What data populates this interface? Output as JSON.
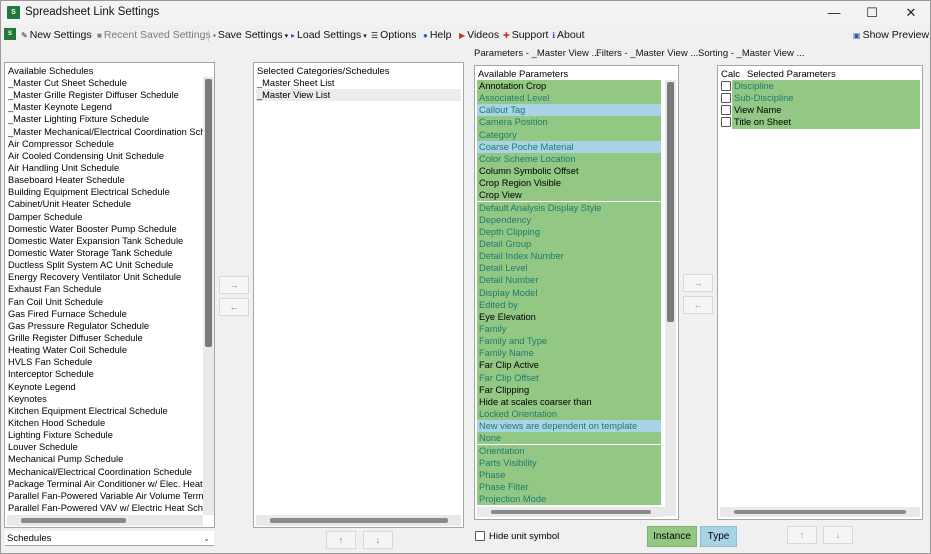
{
  "window": {
    "title": "Spreadsheet Link Settings",
    "app_icon": "S",
    "controls": {
      "minimize": "—",
      "maximize": "☐",
      "close": "✕"
    }
  },
  "toolbar": {
    "new_settings": "New Settings",
    "recent_saved_settings": "Recent Saved Settings",
    "save_settings": "Save Settings",
    "load_settings": "Load Settings",
    "options": "Options",
    "help": "Help",
    "videos": "Videos",
    "support": "Support",
    "about": "About",
    "show_preview": "Show Preview"
  },
  "headers": {
    "parameters": "Parameters - _Master View ...",
    "filters": "Filters - _Master View ...",
    "sorting": "Sorting - _Master View ..."
  },
  "available_schedules": {
    "title": "Available Schedules",
    "items": [
      "_Master Cut Sheet Schedule",
      "_Master Grille Register Diffuser Schedule",
      "_Master Keynote Legend",
      "_Master Lighting Fixture Schedule",
      "_Master Mechanical/Electrical Coordination Sch",
      "Air Compressor Schedule",
      "Air Cooled Condensing Unit Schedule",
      "Air Handling Unit Schedule",
      "Baseboard Heater Schedule",
      "Building Equipment Electrical Schedule",
      "Cabinet/Unit Heater Schedule",
      "Damper Schedule",
      "Domestic Water Booster Pump Schedule",
      "Domestic Water Expansion Tank Schedule",
      "Domestic Water Storage Tank Schedule",
      "Ductless Split System AC Unit Schedule",
      "Energy Recovery Ventilator Unit Schedule",
      "Exhaust Fan Schedule",
      "Fan Coil Unit Schedule",
      "Gas Fired Furnace Schedule",
      "Gas Pressure Regulator Schedule",
      "Grille Register Diffuser Schedule",
      "Heating Water Coil Schedule",
      "HVLS Fan Schedule",
      "Interceptor Schedule",
      "Keynote Legend",
      "Keynotes",
      "Kitchen Equipment Electrical Schedule",
      "Kitchen Hood Schedule",
      "Lighting Fixture Schedule",
      "Louver Schedule",
      "Mechanical Pump Schedule",
      "Mechanical/Electrical Coordination Schedule",
      "Package Terminal Air Conditioner w/ Elec. Heat",
      "Parallel Fan-Powered Variable Air Volume Termi",
      "Parallel Fan-Powered VAV w/ Electric Heat Sche"
    ],
    "dropdown_value": "Schedules"
  },
  "selected_categories": {
    "title": "Selected Categories/Schedules",
    "items": [
      "_Master Sheet List",
      "_Master View List"
    ]
  },
  "available_parameters": {
    "title": "Available Parameters",
    "items": [
      {
        "label": "Annotation Crop",
        "kind": "instance",
        "tone": "dark"
      },
      {
        "label": "Associated Level",
        "kind": "instance",
        "tone": "teal"
      },
      {
        "label": "Callout Tag",
        "kind": "type",
        "tone": "teal"
      },
      {
        "label": "Camera Position",
        "kind": "instance",
        "tone": "teal"
      },
      {
        "label": "Category",
        "kind": "instance",
        "tone": "teal"
      },
      {
        "label": "Coarse Poche Material",
        "kind": "type",
        "tone": "teal"
      },
      {
        "label": "Color Scheme Location",
        "kind": "instance",
        "tone": "teal"
      },
      {
        "label": "Column Symbolic Offset",
        "kind": "instance",
        "tone": "dark"
      },
      {
        "label": "Crop Region Visible",
        "kind": "instance",
        "tone": "dark"
      },
      {
        "label": "Crop View",
        "kind": "instance",
        "tone": "dark"
      },
      {
        "label": "Default Analysis Display Style",
        "kind": "instance",
        "tone": "teal"
      },
      {
        "label": "Dependency",
        "kind": "instance",
        "tone": "teal"
      },
      {
        "label": "Depth Clipping",
        "kind": "instance",
        "tone": "teal"
      },
      {
        "label": "Detail Group",
        "kind": "instance",
        "tone": "teal"
      },
      {
        "label": "Detail Index Number",
        "kind": "instance",
        "tone": "teal"
      },
      {
        "label": "Detail Level",
        "kind": "instance",
        "tone": "teal"
      },
      {
        "label": "Detail Number",
        "kind": "instance",
        "tone": "teal"
      },
      {
        "label": "Display Model",
        "kind": "instance",
        "tone": "teal"
      },
      {
        "label": "Edited by",
        "kind": "instance",
        "tone": "teal"
      },
      {
        "label": "Eye Elevation",
        "kind": "instance",
        "tone": "dark"
      },
      {
        "label": "Family",
        "kind": "instance",
        "tone": "teal"
      },
      {
        "label": "Family and Type",
        "kind": "instance",
        "tone": "teal"
      },
      {
        "label": "Family Name",
        "kind": "instance",
        "tone": "teal"
      },
      {
        "label": "Far Clip Active",
        "kind": "instance",
        "tone": "dark"
      },
      {
        "label": "Far Clip Offset",
        "kind": "instance",
        "tone": "teal"
      },
      {
        "label": "Far Clipping",
        "kind": "instance",
        "tone": "dark"
      },
      {
        "label": "Hide at scales coarser than",
        "kind": "instance",
        "tone": "dark"
      },
      {
        "label": "Locked Orientation",
        "kind": "instance",
        "tone": "teal"
      },
      {
        "label": "New views are dependent on template",
        "kind": "type",
        "tone": "teal"
      },
      {
        "label": "None",
        "kind": "instance",
        "tone": "teal"
      },
      {
        "label": "Orientation",
        "kind": "instance",
        "tone": "teal"
      },
      {
        "label": "Parts Visibility",
        "kind": "instance",
        "tone": "teal"
      },
      {
        "label": "Phase",
        "kind": "instance",
        "tone": "teal"
      },
      {
        "label": "Phase Filter",
        "kind": "instance",
        "tone": "teal"
      },
      {
        "label": "Projection Mode",
        "kind": "instance",
        "tone": "teal"
      }
    ],
    "hide_unit_symbol": "Hide unit symbol"
  },
  "selected_parameters": {
    "calc_header": "Calc",
    "title": "Selected Parameters",
    "items": [
      {
        "label": "Discipline",
        "tone": "teal",
        "checked": false
      },
      {
        "label": "Sub-Discipline",
        "tone": "teal",
        "checked": false
      },
      {
        "label": "View Name",
        "tone": "dark",
        "checked": false
      },
      {
        "label": "Title on Sheet",
        "tone": "dark",
        "checked": false
      }
    ]
  },
  "legend": {
    "instance": "Instance",
    "type": "Type"
  },
  "colors": {
    "instance": "#92c883",
    "type": "#a8d4e6",
    "teal_text": "#1f7a6e"
  },
  "icons": {
    "move_right": "→",
    "move_left": "←",
    "move_up": "↑",
    "move_down": "↓"
  }
}
